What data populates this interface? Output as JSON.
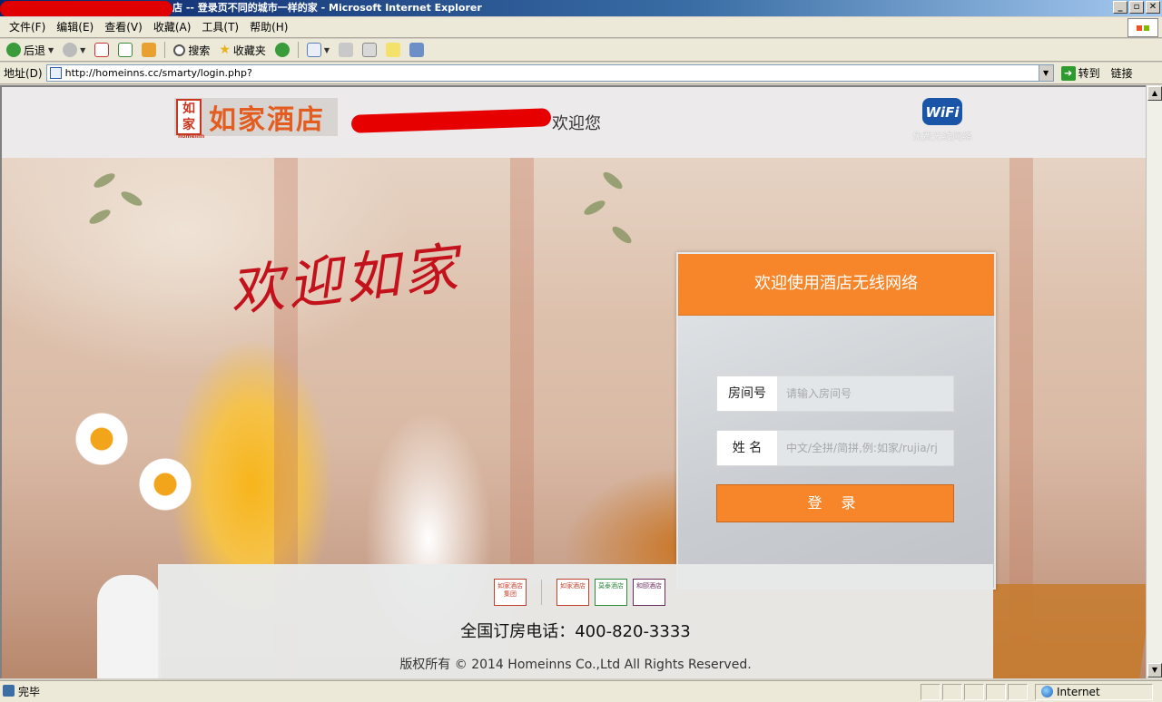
{
  "window": {
    "title": "店 -- 登录页不同的城市一样的家 - Microsoft Internet Explorer",
    "buttons": [
      "_",
      "▫",
      "✕"
    ]
  },
  "menu": [
    "文件(F)",
    "编辑(E)",
    "查看(V)",
    "收藏(A)",
    "工具(T)",
    "帮助(H)"
  ],
  "toolbar": {
    "back": "后退",
    "search": "搜索",
    "favorites": "收藏夹"
  },
  "address": {
    "label": "地址(D)",
    "url": "http://homeinns.cc/smarty/login.php?",
    "go": "转到",
    "links": "链接"
  },
  "site": {
    "logo_text": "如家酒店",
    "logo_seal": "如家",
    "logo_seal_sub": "homeinn",
    "welcome": "欢迎您",
    "wifi_badge": "WiFi",
    "wifi_label": "免费无线网络",
    "hero_slogan": "欢迎如家"
  },
  "login": {
    "header": "欢迎使用酒店无线网络",
    "room_label": "房间号",
    "room_placeholder": "请输入房间号",
    "name_label": "姓 名",
    "name_placeholder": "中文/全拼/简拼,例:如家/rujia/rj",
    "submit": "登 录"
  },
  "footer": {
    "brands": [
      "如家酒店集团",
      "如家酒店",
      "莫泰酒店",
      "和颐酒店"
    ],
    "hotline": "全国订房电话：400-820-3333",
    "copyright": "版权所有 © 2014 Homeinns Co.,Ltd All Rights Reserved."
  },
  "status": {
    "text": "完毕",
    "zone": "Internet"
  },
  "colors": {
    "accent_orange": "#f7862a",
    "logo_orange": "#e35d20",
    "ie_titlebar": "#0a246a"
  }
}
